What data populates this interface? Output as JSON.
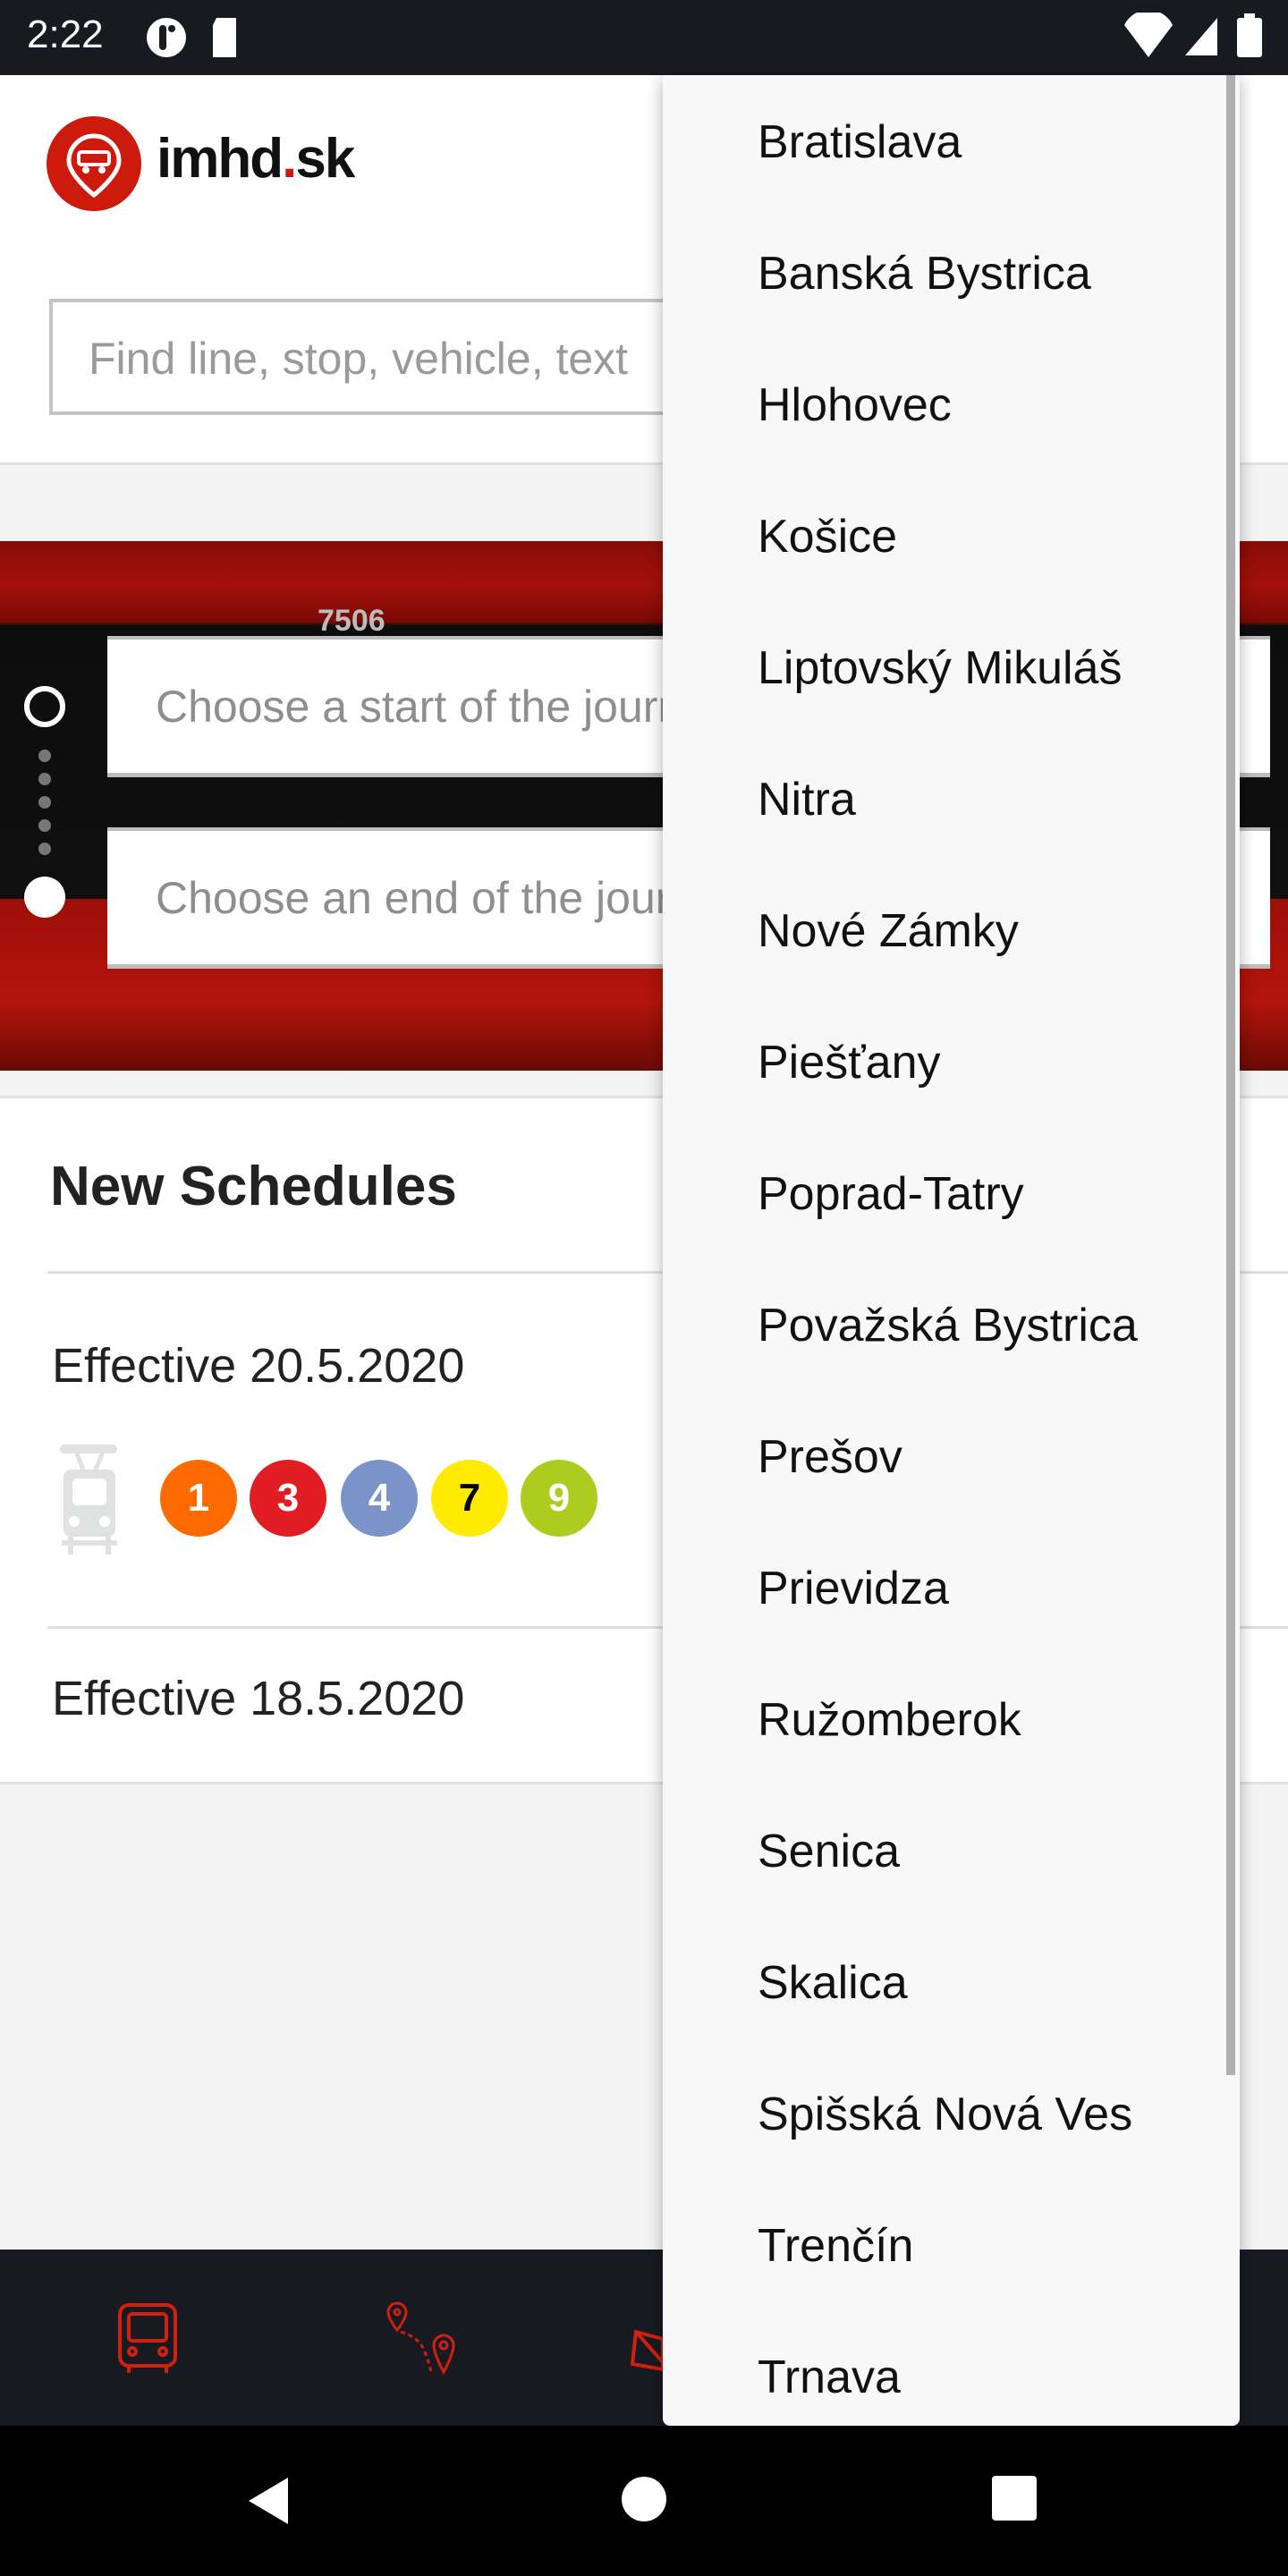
{
  "status_bar": {
    "time": "2:22",
    "icons": [
      "notification-icon",
      "sd-card-icon",
      "wifi-icon",
      "signal-icon",
      "battery-icon"
    ]
  },
  "header": {
    "logo_text_main": "imhd",
    "logo_text_dot": ".",
    "logo_text_tld": "sk",
    "search_placeholder": "Find line, stop, vehicle, text"
  },
  "journey": {
    "banner_number": "7506",
    "start_placeholder": "Choose a start of the journey",
    "end_placeholder": "Choose an end of the journey"
  },
  "schedules": {
    "title": "New Schedules",
    "entries": [
      {
        "label": "Effective 20.5.2020",
        "vehicle_icon": "tram-icon",
        "lines": [
          {
            "number": "1",
            "color": "#ff6a00",
            "text_color": "#ffffff"
          },
          {
            "number": "3",
            "color": "#e11d24",
            "text_color": "#ffffff"
          },
          {
            "number": "4",
            "color": "#7a93c9",
            "text_color": "#ffffff"
          },
          {
            "number": "7",
            "color": "#ffea00",
            "text_color": "#000000"
          },
          {
            "number": "9",
            "color": "#aecb1f",
            "text_color": "#ffffff"
          }
        ]
      },
      {
        "label": "Effective 18.5.2020"
      }
    ]
  },
  "bottom_nav": {
    "icons": [
      "bus-icon",
      "route-icon",
      "map-icon"
    ],
    "accent": "#d0200e"
  },
  "city_dropdown": {
    "items": [
      "Bratislava",
      "Banská Bystrica",
      "Hlohovec",
      "Košice",
      "Liptovský Mikuláš",
      "Nitra",
      "Nové Zámky",
      "Piešťany",
      "Poprad-Tatry",
      "Považská Bystrica",
      "Prešov",
      "Prievidza",
      "Ružomberok",
      "Senica",
      "Skalica",
      "Spišská Nová Ves",
      "Trenčín",
      "Trnava"
    ]
  },
  "colors": {
    "brand": "#cc1a0c",
    "dark": "#171a21"
  }
}
